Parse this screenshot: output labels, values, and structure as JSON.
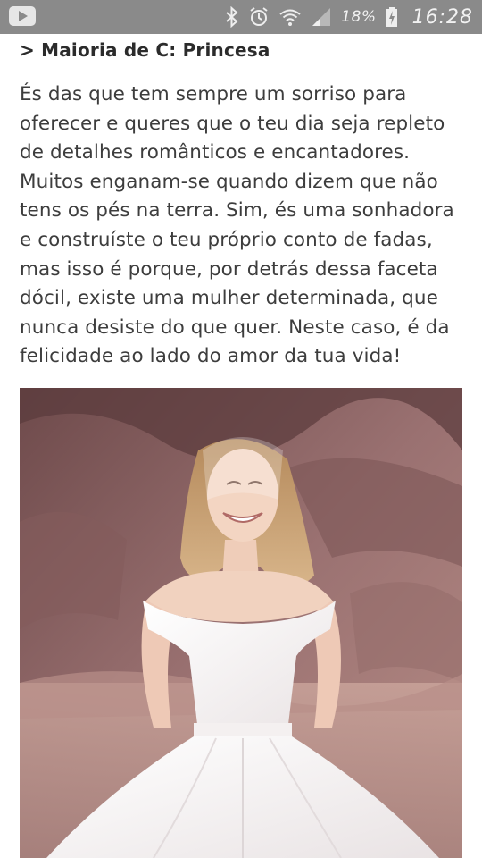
{
  "status_bar": {
    "battery_percent": "18%",
    "time": "16:28",
    "left_icon": "youtube-notification-icon",
    "icons": [
      "bluetooth-icon",
      "alarm-icon",
      "wifi-icon",
      "signal-icon",
      "battery-charging-icon"
    ]
  },
  "article": {
    "heading": "> Maioria de C: Princesa",
    "paragraph": "És das que tem sempre um sorriso para oferecer e queres que o teu dia seja repleto de detalhes românticos e encantadores. Muitos enganam-se quando dizem que não tens os pés na terra. Sim, és uma sonhadora e construíste o teu próprio conto de fadas, mas isso é porque, por detrás dessa faceta dócil, existe uma mulher determinada, que nunca desiste do que quer. Neste caso, é da felicidade ao lado do amor da tua vida!"
  },
  "colors": {
    "status_bar_bg": "#8a8a8a",
    "text": "#3d3d3d",
    "heading": "#2b2b2b"
  }
}
